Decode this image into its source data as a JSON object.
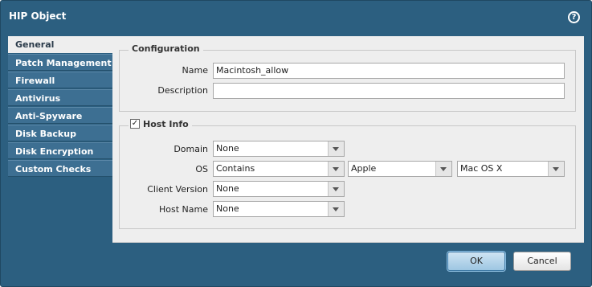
{
  "dialog": {
    "title": "HIP Object",
    "help_glyph": "?"
  },
  "tabs": [
    {
      "label": "General",
      "active": true
    },
    {
      "label": "Patch Management"
    },
    {
      "label": "Firewall"
    },
    {
      "label": "Antivirus"
    },
    {
      "label": "Anti-Spyware"
    },
    {
      "label": "Disk Backup"
    },
    {
      "label": "Disk Encryption"
    },
    {
      "label": "Custom Checks"
    }
  ],
  "configuration": {
    "legend": "Configuration",
    "name_label": "Name",
    "name_value": "Macintosh_allow",
    "description_label": "Description",
    "description_value": ""
  },
  "host_info": {
    "legend": "Host Info",
    "checked": true,
    "check_glyph": "✓",
    "domain_label": "Domain",
    "domain_value": "None",
    "os_label": "OS",
    "os_operator": "Contains",
    "os_vendor": "Apple",
    "os_name": "Mac OS X",
    "client_version_label": "Client Version",
    "client_version_value": "None",
    "host_name_label": "Host Name",
    "host_name_value": "None"
  },
  "buttons": {
    "ok": "OK",
    "cancel": "Cancel"
  },
  "colors": {
    "frame": "#2c5f80",
    "panel": "#eeeeee",
    "tab": "#3d6f92",
    "ok_button": "#9dc6e2"
  }
}
